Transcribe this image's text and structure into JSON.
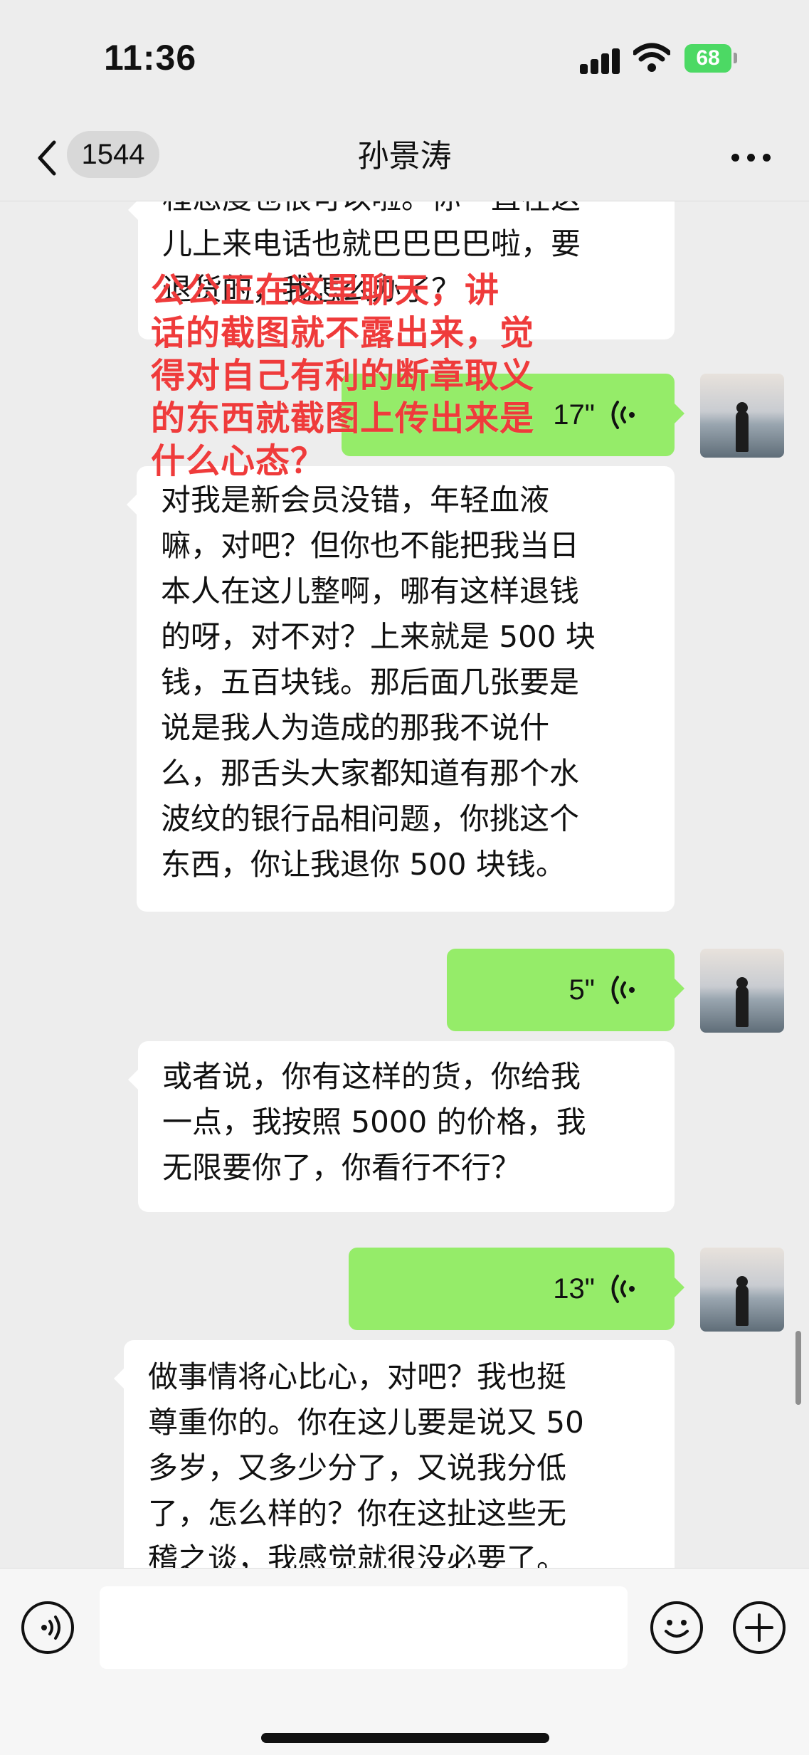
{
  "status_bar": {
    "time": "11:36",
    "battery": "68"
  },
  "nav": {
    "back_count": "1544",
    "title": "孙景涛"
  },
  "messages": [
    {
      "type": "text",
      "side": "left",
      "text": "程态度也很可以啦。你一直在这\n儿上来电话也就巴巴巴巴啦，要\n退货的，我怎么办了？"
    },
    {
      "type": "voice",
      "side": "right",
      "duration": "17\""
    },
    {
      "type": "text",
      "side": "left",
      "text": "对我是新会员没错，年轻血液\n嘛，对吧？但你也不能把我当日\n本人在这儿整啊，哪有这样退钱\n的呀，对不对？上来就是 500 块\n钱，五百块钱。那后面几张要是\n说是我人为造成的那我不说什\n么，那舌头大家都知道有那个水\n波纹的银行品相问题，你挑这个\n东西，你让我退你 500 块钱。"
    },
    {
      "type": "voice",
      "side": "right",
      "duration": "5\""
    },
    {
      "type": "text",
      "side": "left",
      "text": "或者说，你有这样的货，你给我\n一点，我按照 5000 的价格，我\n无限要你了，你看行不行？"
    },
    {
      "type": "voice",
      "side": "right",
      "duration": "13\""
    },
    {
      "type": "text",
      "side": "left",
      "text": "做事情将心比心，对吧？我也挺\n尊重你的。你在这儿要是说又 50\n多岁，又多少分了，又说我分低\n了，怎么样的？你在这扯这些无\n稽之谈，我感觉就很没必要了。"
    }
  ],
  "overlay_caption": "公公正在这里聊天，讲\n话的截图就不露出来，觉\n得对自己有利的断章取义\n的东西就截图上传出来是\n什么心态？",
  "input": {
    "value": "",
    "placeholder": ""
  },
  "icons": [
    "back-chevron-icon",
    "more-dots-icon",
    "voice-wave-icon",
    "voice-input-icon",
    "emoji-icon",
    "plus-icon"
  ],
  "colors": {
    "self_bubble": "#95ec69",
    "other_bubble": "#ffffff",
    "overlay_text": "#ef3b3b",
    "background": "#ededed"
  }
}
